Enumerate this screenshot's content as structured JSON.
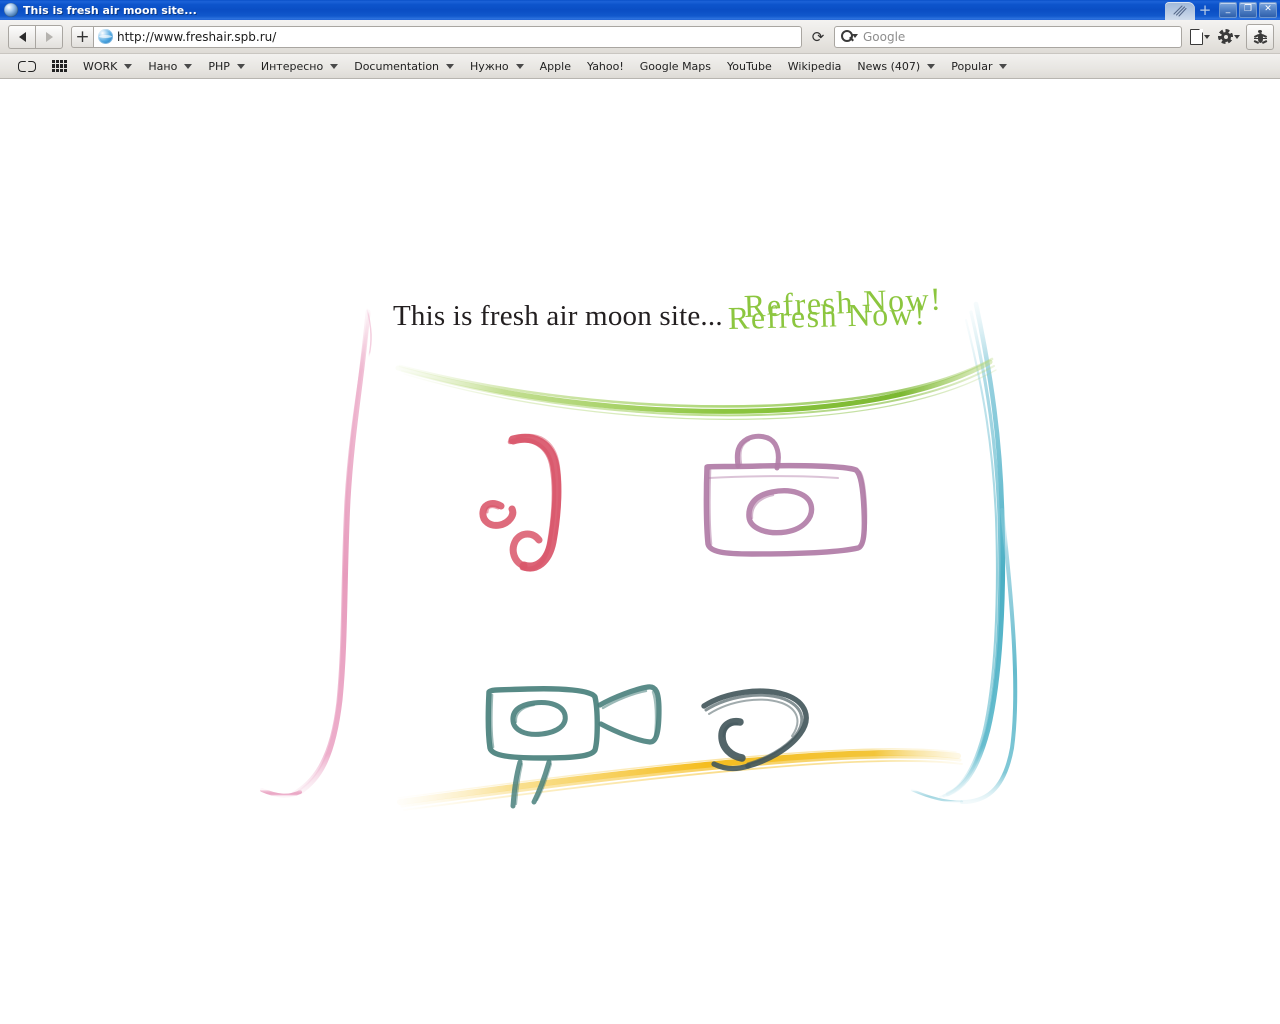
{
  "window": {
    "title": "This is fresh air moon site...",
    "app_icon": "globe-icon",
    "minimize_label": "_",
    "maximize_label": "❐",
    "close_label": "✕",
    "new_tab_label": "+",
    "tab_icon": "lines-icon"
  },
  "toolbar": {
    "back_label": "◀",
    "forward_label": "▶",
    "new_tab_label": "+",
    "url": "http://www.freshair.spb.ru/",
    "reload_label": "⟳",
    "favicon": "globe-icon",
    "search": {
      "engine": "Google",
      "icon": "search-icon"
    },
    "page_menu_label": "page-icon",
    "tools_menu_label": "gear-icon",
    "inspector_label": "bug-icon"
  },
  "bookmarks": {
    "book_icon": "book-icon",
    "apps_icon": "apps-grid-icon",
    "items": [
      {
        "label": "WORK",
        "has_menu": true
      },
      {
        "label": "Нано",
        "has_menu": true
      },
      {
        "label": "PHP",
        "has_menu": true
      },
      {
        "label": "Интересно",
        "has_menu": true
      },
      {
        "label": "Documentation",
        "has_menu": true
      },
      {
        "label": "Нужно",
        "has_menu": true
      },
      {
        "label": "Apple",
        "has_menu": false
      },
      {
        "label": "Yahoo!",
        "has_menu": false
      },
      {
        "label": "Google Maps",
        "has_menu": false
      },
      {
        "label": "YouTube",
        "has_menu": false
      },
      {
        "label": "Wikipedia",
        "has_menu": false
      },
      {
        "label": "News (407)",
        "has_menu": true
      },
      {
        "label": "Popular",
        "has_menu": true
      }
    ]
  },
  "page": {
    "headline": "This is fresh air moon site...",
    "refresh_label_top": "Refresh Now!",
    "refresh_label_bottom": "Refresh Now!",
    "colors": {
      "green": "#8cc63f",
      "pink": "#e8a0bd",
      "teal": "#4aafc4",
      "yellow": "#f5bd1f",
      "rose": "#d9566a",
      "purple": "#b07ba6",
      "seagreen": "#49807c",
      "slate": "#44585c",
      "headline_ink": "#231f20"
    },
    "icons": [
      {
        "name": "moon-hook-brush-icon",
        "color": "#d9566a"
      },
      {
        "name": "bag-camera-brush-icon",
        "color": "#b07ba6"
      },
      {
        "name": "projector-brush-icon",
        "color": "#49807c"
      },
      {
        "name": "curved-arrow-brush-icon",
        "color": "#44585c"
      }
    ]
  }
}
